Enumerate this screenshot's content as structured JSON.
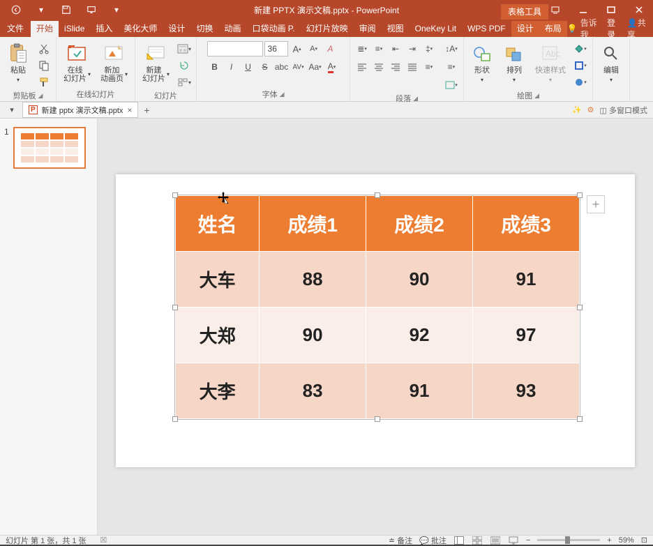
{
  "title": "新建 PPTX 演示文稿.pptx - PowerPoint",
  "contextual_tab": "表格工具",
  "tabs": {
    "file": "文件",
    "home": "开始",
    "islide": "iSlide",
    "insert": "插入",
    "beautify": "美化大师",
    "design": "设计",
    "transition": "切换",
    "animation": "动画",
    "pocket": "口袋动画 P.",
    "slideshow": "幻灯片放映",
    "review": "审阅",
    "view": "视图",
    "onekey": "OneKey Lit",
    "wps": "WPS PDF",
    "design2": "设计",
    "layout": "布局"
  },
  "tellme": "告诉我...",
  "signin": "登录",
  "share": "共享",
  "ribbon": {
    "paste": "粘贴",
    "clipboard": "剪贴板",
    "online_slide": "在线\n幻灯片",
    "new_anim": "新加\n动画页",
    "online_group": "在线幻灯片",
    "new_slide": "新建\n幻灯片",
    "slides_group": "幻灯片",
    "font_group": "字体",
    "font_size": "36",
    "para_group": "段落",
    "shape": "形状",
    "arrange": "排列",
    "quickstyle": "快速样式",
    "drawing_group": "绘图",
    "editing": "编辑"
  },
  "doctab": {
    "name": "新建 pptx 演示文稿.pptx",
    "multiwindow": "多窗口模式"
  },
  "table": {
    "headers": [
      "姓名",
      "成绩1",
      "成绩2",
      "成绩3"
    ],
    "rows": [
      [
        "大车",
        "88",
        "90",
        "91"
      ],
      [
        "大郑",
        "90",
        "92",
        "97"
      ],
      [
        "大李",
        "83",
        "91",
        "93"
      ]
    ]
  },
  "status": {
    "slide_info": "幻灯片 第 1 张，共 1 张",
    "notes": "备注",
    "comments": "批注",
    "zoom": "59%"
  }
}
